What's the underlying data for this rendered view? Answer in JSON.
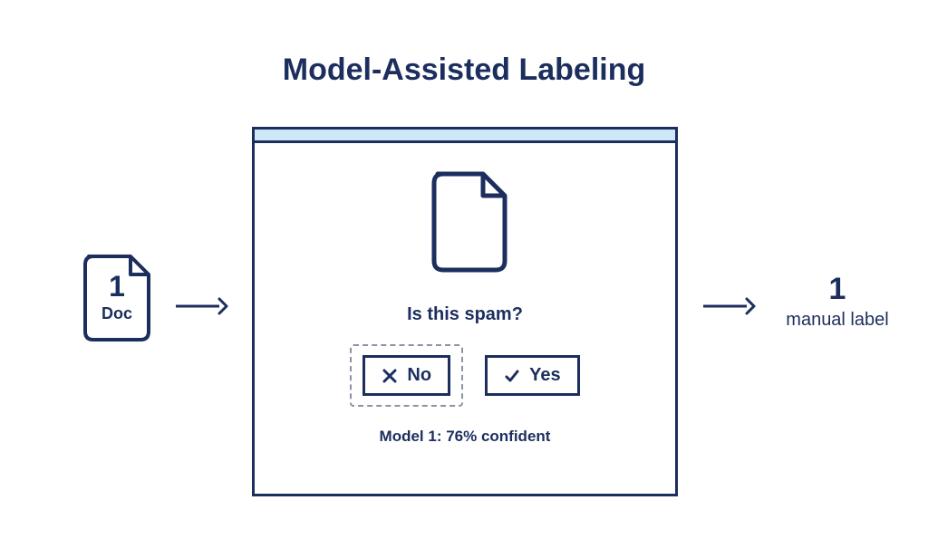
{
  "title": "Model-Assisted Labeling",
  "input": {
    "count": "1",
    "label": "Doc"
  },
  "panel": {
    "prompt": "Is this spam?",
    "no_label": "No",
    "yes_label": "Yes",
    "confidence": "Model 1: 76% confident"
  },
  "output": {
    "count": "1",
    "label": "manual label"
  }
}
